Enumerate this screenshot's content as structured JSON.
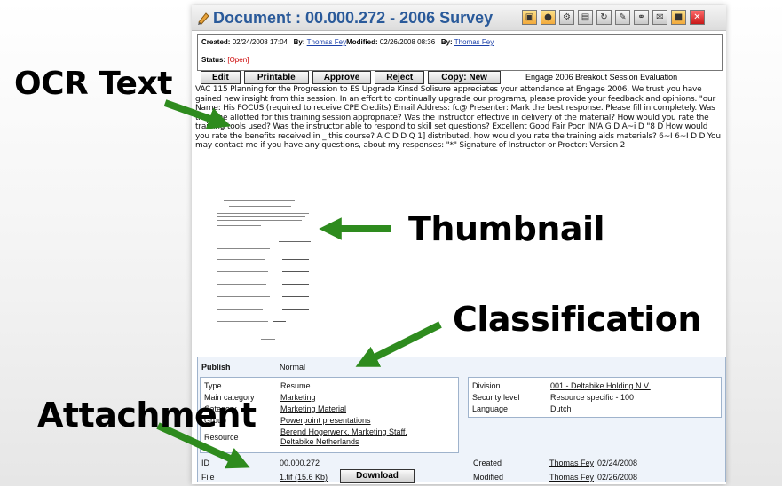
{
  "window": {
    "title": "Document : 00.000.272 - 2006 Survey",
    "toolbar_icons": [
      "save-icon",
      "search-icon",
      "settings-icon",
      "print-icon",
      "refresh-icon",
      "edit-icon",
      "link-icon",
      "mail-icon",
      "lock-icon",
      "close-icon"
    ]
  },
  "meta": {
    "created_label": "Created:",
    "created_value": "02/24/2008 17:04",
    "by_label": "By:",
    "created_by": "Thomas Fey",
    "modified_label": "Modified:",
    "modified_value": "02/26/2008 08:36",
    "modified_by": "Thomas Fey",
    "status_label": "Status:",
    "status_value": "[Open]"
  },
  "buttons": {
    "edit": "Edit",
    "printable": "Printable",
    "approve": "Approve",
    "reject": "Reject",
    "copy_new": "Copy: New",
    "download": "Download"
  },
  "ocr": {
    "heading": "Engage 2006 Breakout Session Evaluation",
    "text": "VAC 115 Planning for the Progression to ES Upgrade Kinsd Solisure appreciates your attendance at Engage 2006. We trust you have gained new insight from this session. In an effort to continually upgrade our programs, please provide your feedback and opinions. \"our Name: His  FOCUS (required to receive CPE Credits) Email Address: fc@ Presenter: Mark the best response. Please fill in completely. Was the time allotted for this training session appropriate? Was the instructor effective in delivery of the material? How would you rate the training tools used? Was the instructor able to respond to skill set questions? Excellent Good Fair Poor IN/A  G D A~i D \"8 D How would you rate the benefits received in _ this course? A C D D Q 1] distributed, how would you rate the training aids materials?  6~I 6~I D D  You may contact me if you have any questions, about my responses: \"*\" Signature of Instructor or Proctor: Version 2"
  },
  "classification": {
    "publish_label": "Publish",
    "publish_value": "Normal",
    "type_label": "Type",
    "type_value": "Resume",
    "main_category_label": "Main category",
    "main_category_value": "Marketing",
    "sub_category_label": "Category",
    "sub_category_value": "Marketing Material",
    "group_label": "Group",
    "group_value": "Powerpoint presentations",
    "resource_label": "Resource",
    "resource_value_1": "Berend Hogerwerk, Marketing Staff,",
    "resource_value_2": "Deltabike Netherlands",
    "division_label": "Division",
    "division_value": "001 - Deltabike Holding N.V.",
    "security_label": "Security level",
    "security_value": "Resource specific - 100",
    "language_label": "Language",
    "language_value": "Dutch",
    "id_label": "ID",
    "id_value": "00.000.272",
    "file_label": "File",
    "file_value": "1.tif (15.6 Kb)",
    "created_label": "Created",
    "created_by": "Thomas Fey",
    "created_date": "02/24/2008",
    "modified_label": "Modified",
    "modified_by": "Thomas Fey",
    "modified_date": "02/26/2008"
  },
  "callouts": {
    "ocr_text": "OCR Text",
    "thumbnail": "Thumbnail",
    "classification": "Classification",
    "attachment": "Attachment"
  },
  "colors": {
    "title": "#2a5a9a",
    "arrow": "#2e8b1e",
    "link": "#1a3fa8",
    "status_open": "#cc0000"
  }
}
